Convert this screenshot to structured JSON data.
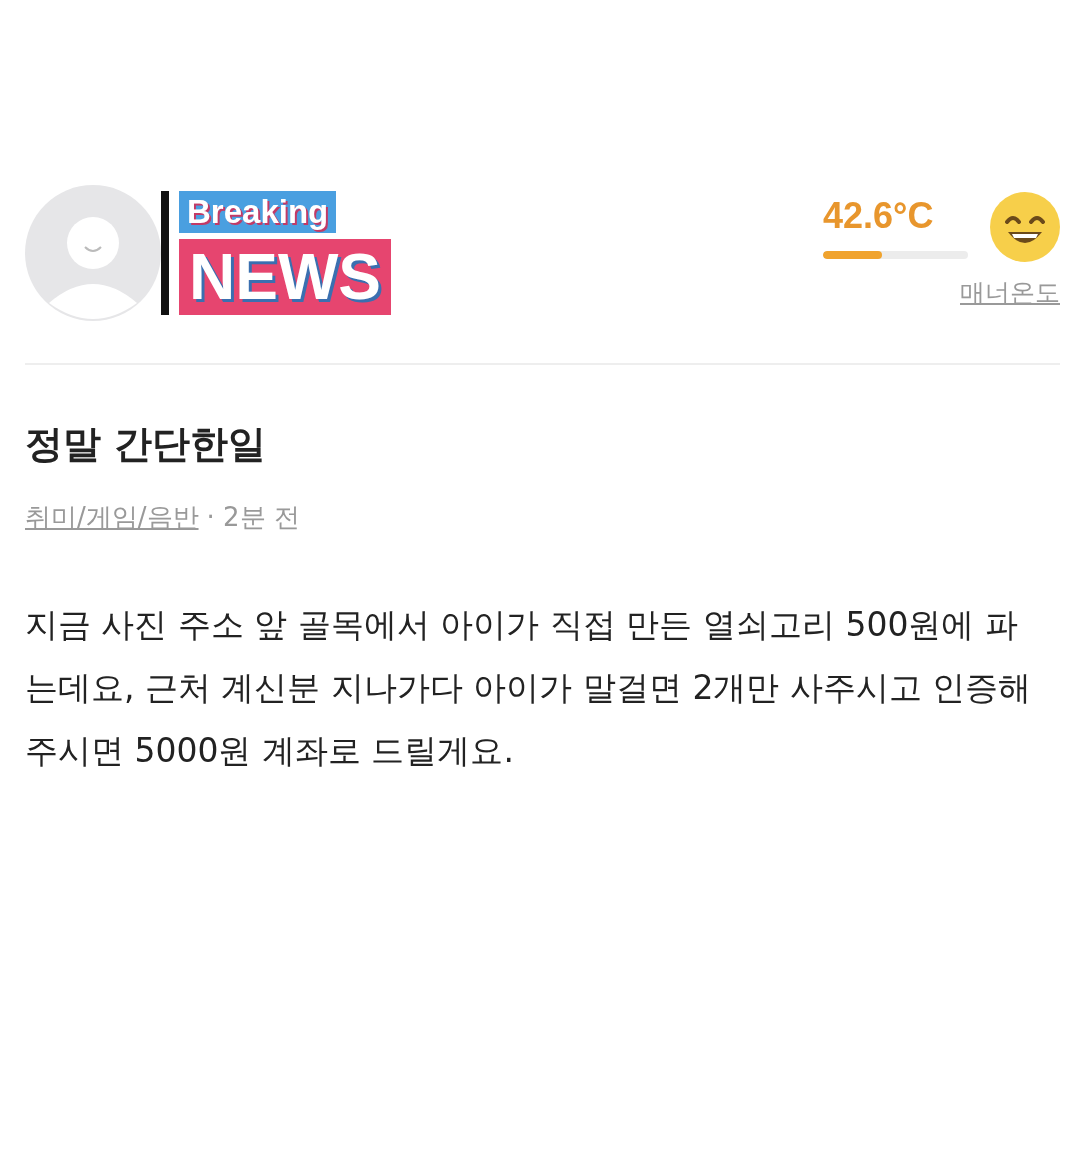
{
  "profile": {
    "badge_top": "Breaking",
    "badge_bottom": "NEWS"
  },
  "manner": {
    "temperature": "42.6°C",
    "level": 0.41,
    "label": "매너온도"
  },
  "post": {
    "title": "정말 간단한일",
    "category": "취미/게임/음반",
    "time": "· 2분 전",
    "body": "지금 사진 주소 앞 골목에서 아이가 직접 만든 열쇠고리 500원에 파는데요, 근처 계신분 지나가다 아이가 말걸면 2개만 사주시고 인증해주시면 5000원 계좌로 드릴게요."
  }
}
